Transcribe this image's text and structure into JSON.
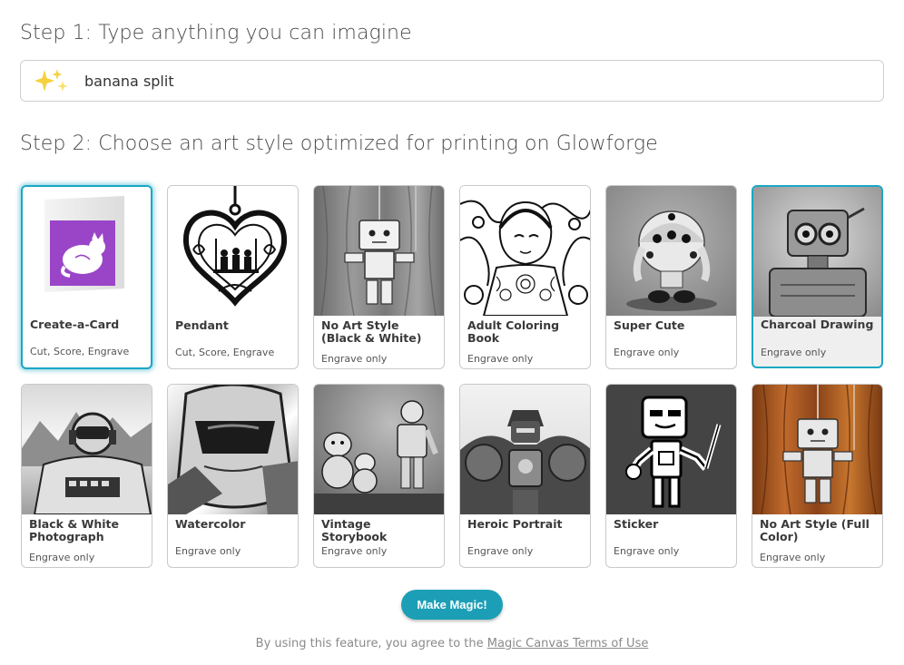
{
  "step1": {
    "title": "Step 1: Type anything you can imagine",
    "prompt_value": "banana split",
    "icon": "sparkles-icon"
  },
  "step2": {
    "title": "Step 2: Choose an art style optimized for printing on Glowforge"
  },
  "styles": [
    {
      "title": "Create-a-Card",
      "sub": "Cut, Score, Engrave",
      "selected": true
    },
    {
      "title": "Pendant",
      "sub": "Cut, Score, Engrave"
    },
    {
      "title": "No Art Style (Black & White)",
      "sub": "Engrave only"
    },
    {
      "title": "Adult Coloring Book",
      "sub": "Engrave only"
    },
    {
      "title": "Super Cute",
      "sub": "Engrave only"
    },
    {
      "title": "Charcoal Drawing",
      "sub": "Engrave only",
      "hovered": true
    },
    {
      "title": "Black & White Photograph",
      "sub": "Engrave only"
    },
    {
      "title": "Watercolor",
      "sub": "Engrave only"
    },
    {
      "title": "Vintage Storybook",
      "sub": "Engrave only"
    },
    {
      "title": "Heroic Portrait",
      "sub": "Engrave only"
    },
    {
      "title": "Sticker",
      "sub": "Engrave only"
    },
    {
      "title": "No Art Style (Full Color)",
      "sub": "Engrave only"
    }
  ],
  "make_magic_label": "Make Magic!",
  "terms": {
    "text": "By using this feature, you agree to the",
    "link": "Magic Canvas Terms of Use"
  },
  "colors": {
    "accent": "#1c9fb6",
    "selected_border": "#1aa7c4",
    "card_purple": "#9a45c8"
  }
}
